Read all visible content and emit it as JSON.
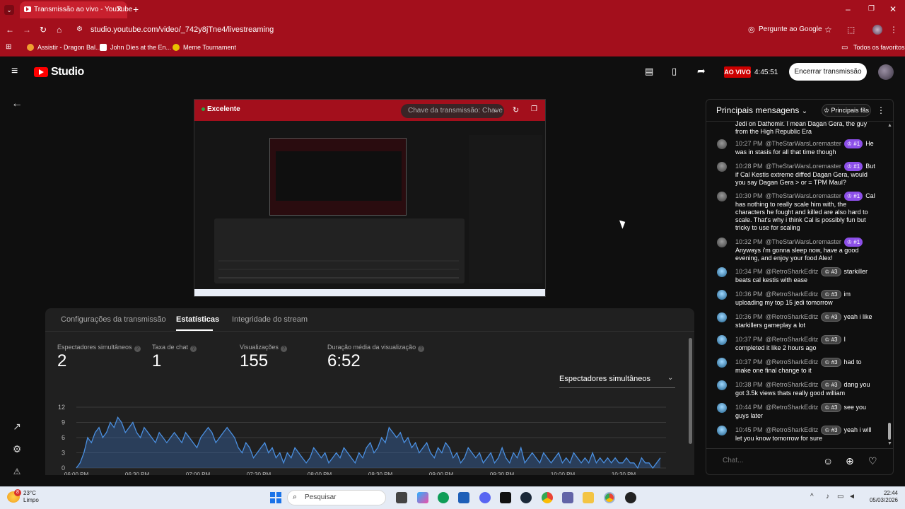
{
  "browser": {
    "tab_title": "Transmissão ao vivo - YouTube",
    "url": "studio.youtube.com/video/_742y8jTne4/livestreaming",
    "ask_google": "Pergunte ao Google",
    "bookmarks": [
      "Assistir - Dragon Bal...",
      "John Dies at the En...",
      "Meme Tournament"
    ],
    "all_favorites": "Todos os favoritos"
  },
  "studio": {
    "logo_text": "Studio",
    "live_label": "AO VIVO",
    "live_time": "4:45:51",
    "end_button": "Encerrar transmissão"
  },
  "preview": {
    "quality": "Excelente",
    "stream_key_placeholder": "Chave da transmissão: Chave"
  },
  "tabs": [
    "Configurações da transmissão",
    "Estatísticas",
    "Integridade do stream"
  ],
  "metrics": [
    {
      "label": "Espectadores simultâneos",
      "value": "2"
    },
    {
      "label": "Taxa de chat",
      "value": "1"
    },
    {
      "label": "Visualizações",
      "value": "155"
    },
    {
      "label": "Duração média da visualização",
      "value": "6:52"
    }
  ],
  "metric_selector": "Espectadores simultâneos",
  "chart_data": {
    "type": "area",
    "x_ticks": [
      "06:00 PM",
      "06:30 PM",
      "07:00 PM",
      "07:30 PM",
      "08:00 PM",
      "08:30 PM",
      "09:00 PM",
      "09:30 PM",
      "10:00 PM",
      "10:30 PM"
    ],
    "y_ticks": [
      0,
      3,
      6,
      9,
      12
    ],
    "ylim": [
      0,
      12
    ],
    "grid": true,
    "values": [
      0,
      1,
      3,
      6,
      5,
      7,
      8,
      6,
      7,
      9,
      8,
      10,
      9,
      7,
      8,
      9,
      7,
      6,
      8,
      7,
      6,
      5,
      7,
      6,
      5,
      6,
      7,
      6,
      5,
      7,
      6,
      5,
      4,
      6,
      7,
      8,
      7,
      5,
      6,
      7,
      8,
      7,
      6,
      4,
      3,
      5,
      4,
      2,
      3,
      4,
      5,
      3,
      4,
      2,
      3,
      1,
      3,
      2,
      4,
      3,
      2,
      1,
      2,
      4,
      3,
      2,
      3,
      1,
      2,
      3,
      2,
      4,
      3,
      2,
      1,
      3,
      2,
      4,
      5,
      3,
      4,
      6,
      5,
      8,
      7,
      6,
      7,
      5,
      6,
      4,
      5,
      3,
      4,
      5,
      3,
      2,
      4,
      3,
      5,
      4,
      2,
      3,
      1,
      2,
      4,
      3,
      2,
      3,
      1,
      2,
      3,
      1,
      2,
      4,
      2,
      1,
      3,
      2,
      4,
      1,
      2,
      3,
      2,
      1,
      3,
      2,
      1,
      2,
      3,
      1,
      2,
      1,
      3,
      2,
      1,
      2,
      1,
      3,
      1,
      2,
      1,
      2,
      1,
      2,
      1,
      1,
      2,
      1,
      1,
      0,
      2,
      1,
      1,
      0,
      1,
      2
    ]
  },
  "chat": {
    "header": "Principais mensagens",
    "fans_button": "Principais fãs",
    "partial_top": "Jedi on Dathomir. I mean Dagan Gera, the guy from the High Republic Era",
    "messages": [
      {
        "time": "10:27 PM",
        "author": "@TheStarWarsLoremaster",
        "badge": "#1",
        "text": "He was in stasis for all that time though"
      },
      {
        "time": "10:28 PM",
        "author": "@TheStarWarsLoremaster",
        "badge": "#1",
        "text": "But if Cal Kestis extreme diffed Dagan Gera, would you say Dagan Gera > or = TPM Maul?"
      },
      {
        "time": "10:30 PM",
        "author": "@TheStarWarsLoremaster",
        "badge": "#1",
        "text": "Cal has nothing to really scale him with, the characters he fought and killed are also hard to scale. That's why i think Cal is possibly fun but tricky to use for scaling"
      },
      {
        "time": "10:32 PM",
        "author": "@TheStarWarsLoremaster",
        "badge": "#1",
        "text": "Anyways i'm gonna sleep now, have a good evening, and enjoy your food Alex!"
      },
      {
        "time": "10:34 PM",
        "author": "@RetroSharkEditz",
        "badge": "#3",
        "text": "starkiller beats cal kestis with ease"
      },
      {
        "time": "10:36 PM",
        "author": "@RetroSharkEditz",
        "badge": "#3",
        "text": "im uploading my top 15 jedi tomorrow"
      },
      {
        "time": "10:36 PM",
        "author": "@RetroSharkEditz",
        "badge": "#3",
        "text": "yeah i like starkillers gameplay a lot"
      },
      {
        "time": "10:37 PM",
        "author": "@RetroSharkEditz",
        "badge": "#3",
        "text": "I completed it like 2 hours ago"
      },
      {
        "time": "10:37 PM",
        "author": "@RetroSharkEditz",
        "badge": "#3",
        "text": "had to make one final change to it"
      },
      {
        "time": "10:38 PM",
        "author": "@RetroSharkEditz",
        "badge": "#3",
        "text": "dang you got 3.5k views thats really good william"
      },
      {
        "time": "10:44 PM",
        "author": "@RetroSharkEditz",
        "badge": "#3",
        "text": "see you guys later"
      },
      {
        "time": "10:45 PM",
        "author": "@RetroSharkEditz",
        "badge": "#3",
        "text": "yeah i will let you know tomorrow for sure"
      }
    ],
    "input_placeholder": "Chat..."
  },
  "taskbar": {
    "temp": "23°C",
    "condition": "Limpo",
    "weather_badge": "8",
    "search": "Pesquisar",
    "time": "22:44",
    "date": "05/03/2026"
  }
}
